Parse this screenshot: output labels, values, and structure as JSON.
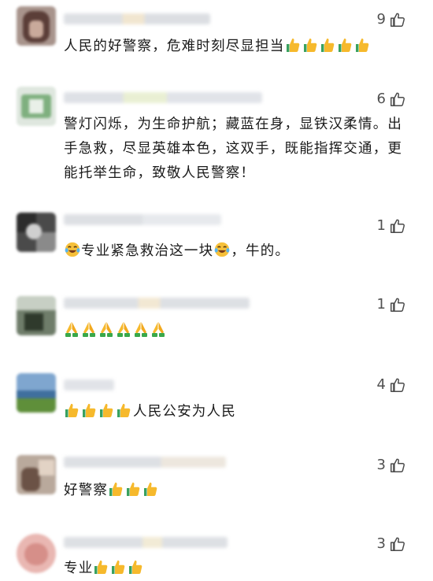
{
  "comments": [
    {
      "likes": "9",
      "text": "人民的好警察，危难时刻尽显担当",
      "suffix_emoji": "thumbs-up-icon",
      "suffix_count": 5,
      "prefix_count": 0
    },
    {
      "likes": "6",
      "text": "警灯闪烁，为生命护航；藏蓝在身，显铁汉柔情。出手急救，尽显英雄本色，这双手，既能指挥交通，更能托举生命，致敬人民警察！"
    },
    {
      "likes": "1",
      "text_parts": [
        "专业紧急救治这一块",
        "，牛的。"
      ],
      "inline_emoji": "laughing-tears-icon"
    },
    {
      "likes": "1",
      "text": "",
      "suffix_emoji": "folded-hands-icon",
      "suffix_count": 6
    },
    {
      "likes": "4",
      "text": "人民公安为人民",
      "prefix_emoji": "thumbs-up-icon",
      "prefix_count": 4
    },
    {
      "likes": "3",
      "text": "好警察",
      "suffix_emoji": "thumbs-up-icon",
      "suffix_count": 3
    },
    {
      "likes": "3",
      "text": "专业",
      "suffix_emoji": "thumbs-up-icon",
      "suffix_count": 3
    }
  ],
  "colors": {
    "text": "#1a1a1a",
    "like_count": "#505050",
    "thumb_yellow": "#f6b92c",
    "sleeve_green": "#3aa84a",
    "sleeve_blue": "#3a7bd5"
  }
}
